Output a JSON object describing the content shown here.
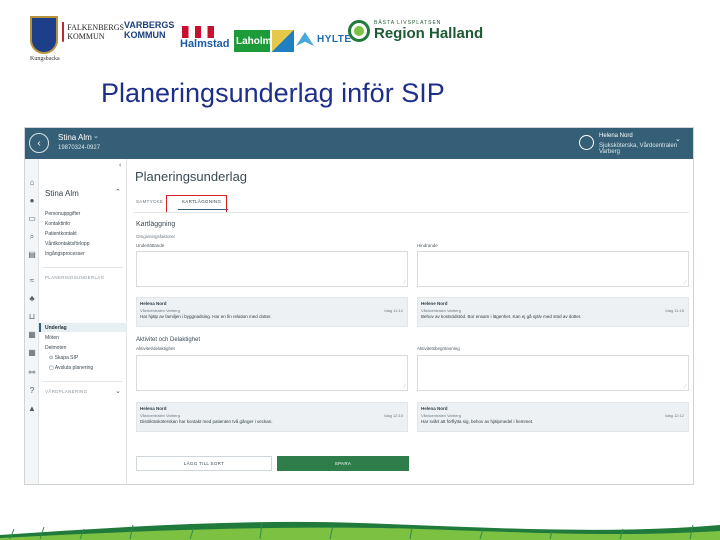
{
  "slide": {
    "title": "Planeringsunderlag inför SIP",
    "logos": {
      "crest_label": "Kungsbacka",
      "falkenberg": [
        "FALKENBERGS",
        "KOMMUN"
      ],
      "varberg": [
        "VARBERGS",
        "KOMMUN"
      ],
      "halmstad": "Halmstad",
      "laholm": "Laholm",
      "hylte": "HYLTE",
      "region_small": "BÄSTA LIVSPLATSEN",
      "region_big": "Region Halland"
    }
  },
  "app": {
    "colors": {
      "header": "#355f76",
      "primary_button": "#2e7d4a",
      "highlight": "#d2201f"
    },
    "header": {
      "patient_name": "Stina Alm",
      "patient_id": "19870324-0927",
      "user_name": "Helena Nord",
      "user_role": "Sjuksköterska, Vårdcentralen Varberg"
    },
    "iconbar": [
      "home-icon",
      "person-icon",
      "inbox-icon",
      "search-icon",
      "document-icon",
      "chart-icon",
      "team-icon",
      "cart-icon",
      "calendar-icon",
      "link-icon",
      "help-icon",
      "education-icon"
    ],
    "sidebar": {
      "name": "Stina Alm",
      "items": [
        "Personuppgifter",
        "Kontaktinfo",
        "Patientkontakt",
        "Vårdkontaktsförlopp",
        "Ingångsprocesser"
      ],
      "section_1": "PLANERINGSUNDERLAG",
      "selected": "Underlag",
      "sub_items": [
        "Möten",
        "Delmoten",
        "Skapa SIP",
        "Avsluta planering"
      ],
      "section_2": "VÅRDPLANERING"
    },
    "page": {
      "heading": "Planeringsunderlag",
      "tabs": [
        "SAMTYCKE",
        "KARTLÄGGNING"
      ],
      "section_kartlaggning": "Kartläggning",
      "sub_kartlaggning": "Omgivningsfaktorer",
      "left_field_1": "Underlättande",
      "right_field_1": "Hindrande",
      "section_aktivitet": "Aktivitet och Delaktighet",
      "left_field_2": "Aktivitet/delaktighet",
      "right_field_2": "Aktivitetsbegränsning",
      "comments": [
        {
          "who": "Helena Nord",
          "what": "Vårdcentralen Varberg",
          "text": "Har hjälp av familjen i byggnadsing. Har en fin relation med dotter.",
          "date": "Idag 11:12"
        },
        {
          "who": "Helene Nord",
          "what": "Vårdcentralen Varberg",
          "text": "Behov av kostsödstöd. Bor ensam i lägenhet. Kan ej gå själv med stöd av dotter.",
          "date": "Idag 11:15"
        },
        {
          "who": "Helena Nord",
          "what": "Vårdcentralen Varberg",
          "text": "Distriktssköterskan har kontakt med patienten två gånger i veckan.",
          "date": "Idag 12:10"
        },
        {
          "who": "Helena Nord",
          "what": "Vårdcentralen Varberg",
          "text": "Har svårt att förflytta sig, behov av hjälpmedel i hemmet.",
          "date": "Idag 12:12"
        }
      ],
      "button_secondary": "LÄGG TILL SORT",
      "button_primary": "SPARA"
    }
  }
}
